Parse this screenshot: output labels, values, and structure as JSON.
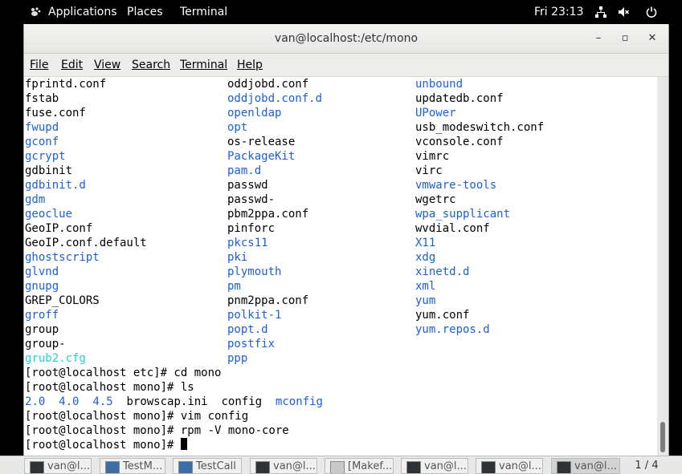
{
  "top_panel": {
    "applications": "Applications",
    "places": "Places",
    "terminal": "Terminal",
    "clock": "Fri 23:13"
  },
  "window": {
    "title": "van@localhost:/etc/mono",
    "minimize": "–",
    "maximize": "▫",
    "close": "✕"
  },
  "menu": [
    "File",
    "Edit",
    "View",
    "Search",
    "Terminal",
    "Help"
  ],
  "listing": [
    [
      {
        "t": "fprintd.conf",
        "c": "n"
      },
      {
        "t": "oddjobd.conf",
        "c": "n"
      },
      {
        "t": "unbound",
        "c": "b"
      }
    ],
    [
      {
        "t": "fstab",
        "c": "n"
      },
      {
        "t": "oddjobd.conf.d",
        "c": "b"
      },
      {
        "t": "updatedb.conf",
        "c": "n"
      }
    ],
    [
      {
        "t": "fuse.conf",
        "c": "n"
      },
      {
        "t": "openldap",
        "c": "b"
      },
      {
        "t": "UPower",
        "c": "b"
      }
    ],
    [
      {
        "t": "fwupd",
        "c": "b"
      },
      {
        "t": "opt",
        "c": "b"
      },
      {
        "t": "usb_modeswitch.conf",
        "c": "n"
      }
    ],
    [
      {
        "t": "gconf",
        "c": "b"
      },
      {
        "t": "os-release",
        "c": "n"
      },
      {
        "t": "vconsole.conf",
        "c": "n"
      }
    ],
    [
      {
        "t": "gcrypt",
        "c": "b"
      },
      {
        "t": "PackageKit",
        "c": "b"
      },
      {
        "t": "vimrc",
        "c": "n"
      }
    ],
    [
      {
        "t": "gdbinit",
        "c": "n"
      },
      {
        "t": "pam.d",
        "c": "b"
      },
      {
        "t": "virc",
        "c": "n"
      }
    ],
    [
      {
        "t": "gdbinit.d",
        "c": "b"
      },
      {
        "t": "passwd",
        "c": "n"
      },
      {
        "t": "vmware-tools",
        "c": "b"
      }
    ],
    [
      {
        "t": "gdm",
        "c": "b"
      },
      {
        "t": "passwd-",
        "c": "n"
      },
      {
        "t": "wgetrc",
        "c": "n"
      }
    ],
    [
      {
        "t": "geoclue",
        "c": "b"
      },
      {
        "t": "pbm2ppa.conf",
        "c": "n"
      },
      {
        "t": "wpa_supplicant",
        "c": "b"
      }
    ],
    [
      {
        "t": "GeoIP.conf",
        "c": "n"
      },
      {
        "t": "pinforc",
        "c": "n"
      },
      {
        "t": "wvdial.conf",
        "c": "n"
      }
    ],
    [
      {
        "t": "GeoIP.conf.default",
        "c": "n"
      },
      {
        "t": "pkcs11",
        "c": "b"
      },
      {
        "t": "X11",
        "c": "b"
      }
    ],
    [
      {
        "t": "ghostscript",
        "c": "b"
      },
      {
        "t": "pki",
        "c": "b"
      },
      {
        "t": "xdg",
        "c": "b"
      }
    ],
    [
      {
        "t": "glvnd",
        "c": "b"
      },
      {
        "t": "plymouth",
        "c": "b"
      },
      {
        "t": "xinetd.d",
        "c": "b"
      }
    ],
    [
      {
        "t": "gnupg",
        "c": "b"
      },
      {
        "t": "pm",
        "c": "b"
      },
      {
        "t": "xml",
        "c": "b"
      }
    ],
    [
      {
        "t": "GREP_COLORS",
        "c": "n"
      },
      {
        "t": "pnm2ppa.conf",
        "c": "n"
      },
      {
        "t": "yum",
        "c": "b"
      }
    ],
    [
      {
        "t": "groff",
        "c": "b"
      },
      {
        "t": "polkit-1",
        "c": "b"
      },
      {
        "t": "yum.conf",
        "c": "n"
      }
    ],
    [
      {
        "t": "group",
        "c": "n"
      },
      {
        "t": "popt.d",
        "c": "b"
      },
      {
        "t": "yum.repos.d",
        "c": "b"
      }
    ],
    [
      {
        "t": "group-",
        "c": "n"
      },
      {
        "t": "postfix",
        "c": "b"
      },
      {
        "t": "",
        "c": "n"
      }
    ],
    [
      {
        "t": "grub2.cfg",
        "c": "c"
      },
      {
        "t": "ppp",
        "c": "b"
      },
      {
        "t": "",
        "c": "n"
      }
    ]
  ],
  "commands": {
    "cd": "[root@localhost etc]# cd mono",
    "ls": "[root@localhost mono]# ls",
    "ls_output": [
      {
        "t": "2.0",
        "c": "b"
      },
      {
        "t": "4.0",
        "c": "b"
      },
      {
        "t": "4.5",
        "c": "b"
      },
      {
        "t": "browscap.ini",
        "c": "n"
      },
      {
        "t": "config",
        "c": "n"
      },
      {
        "t": "mconfig",
        "c": "b"
      }
    ],
    "vim": "[root@localhost mono]# vim config",
    "rpm": "[root@localhost mono]# rpm -V mono-core",
    "prompt": "[root@localhost mono]# "
  },
  "taskbar": [
    {
      "label": "van@l...",
      "icon": "terminal-icon"
    },
    {
      "label": "TestM...",
      "icon": "app-icon"
    },
    {
      "label": "TestCall",
      "icon": "app-icon"
    },
    {
      "label": "van@l...",
      "icon": "terminal-icon"
    },
    {
      "label": "[Makef...",
      "icon": "text-editor-icon"
    },
    {
      "label": "van@l...",
      "icon": "terminal-icon"
    },
    {
      "label": "van@l...",
      "icon": "terminal-icon"
    },
    {
      "label": "van@l...",
      "icon": "terminal-icon"
    }
  ],
  "workspace": "1 / 4"
}
